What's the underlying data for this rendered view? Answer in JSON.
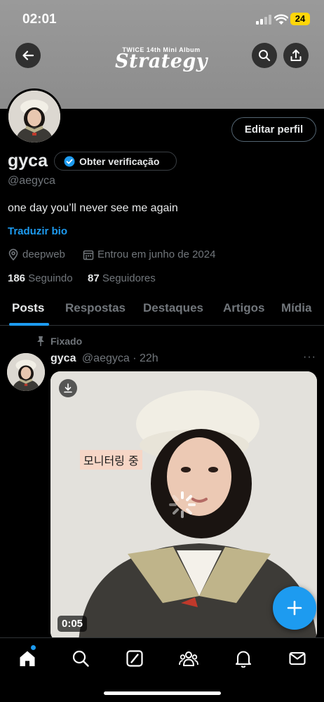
{
  "status_bar": {
    "time": "02:01",
    "battery": "24"
  },
  "banner": {
    "album_subtitle": "TWICE 14th Mini Album",
    "album_title": "Strategy"
  },
  "profile": {
    "edit_button": "Editar perfil",
    "name": "gyca",
    "verify_button": "Obter verificação",
    "handle": "@aegyca",
    "bio": "one day you’ll never see me again",
    "translate_bio": "Traduzir bio",
    "location": "deepweb",
    "joined": "Entrou em junho de 2024",
    "following_count": "186",
    "following_label": "Seguindo",
    "followers_count": "87",
    "followers_label": "Seguidores"
  },
  "tabs": [
    {
      "label": "Posts",
      "active": true
    },
    {
      "label": "Respostas",
      "active": false
    },
    {
      "label": "Destaques",
      "active": false
    },
    {
      "label": "Artigos",
      "active": false
    },
    {
      "label": "Mídia",
      "active": false
    }
  ],
  "pinned_post": {
    "pinned_label": "Fixado",
    "author_name": "gyca",
    "author_handle": "@aegyca",
    "time": "· 22h",
    "more": "···",
    "media_caption": "모니터링 중",
    "duration": "0:05"
  },
  "colors": {
    "accent": "#1d9bf0",
    "background": "#000000",
    "secondary_text": "#71767b",
    "battery": "#ffd60a"
  },
  "icons": {
    "back": "arrow-left-icon",
    "search": "search-icon",
    "share": "share-icon",
    "verified": "verified-badge-icon",
    "location": "location-pin-icon",
    "calendar": "calendar-icon",
    "pin": "pin-icon",
    "download": "download-icon",
    "compose": "plus-icon",
    "nav": [
      "home-icon",
      "search-icon",
      "grok-icon",
      "communities-icon",
      "notifications-icon",
      "messages-icon"
    ]
  }
}
